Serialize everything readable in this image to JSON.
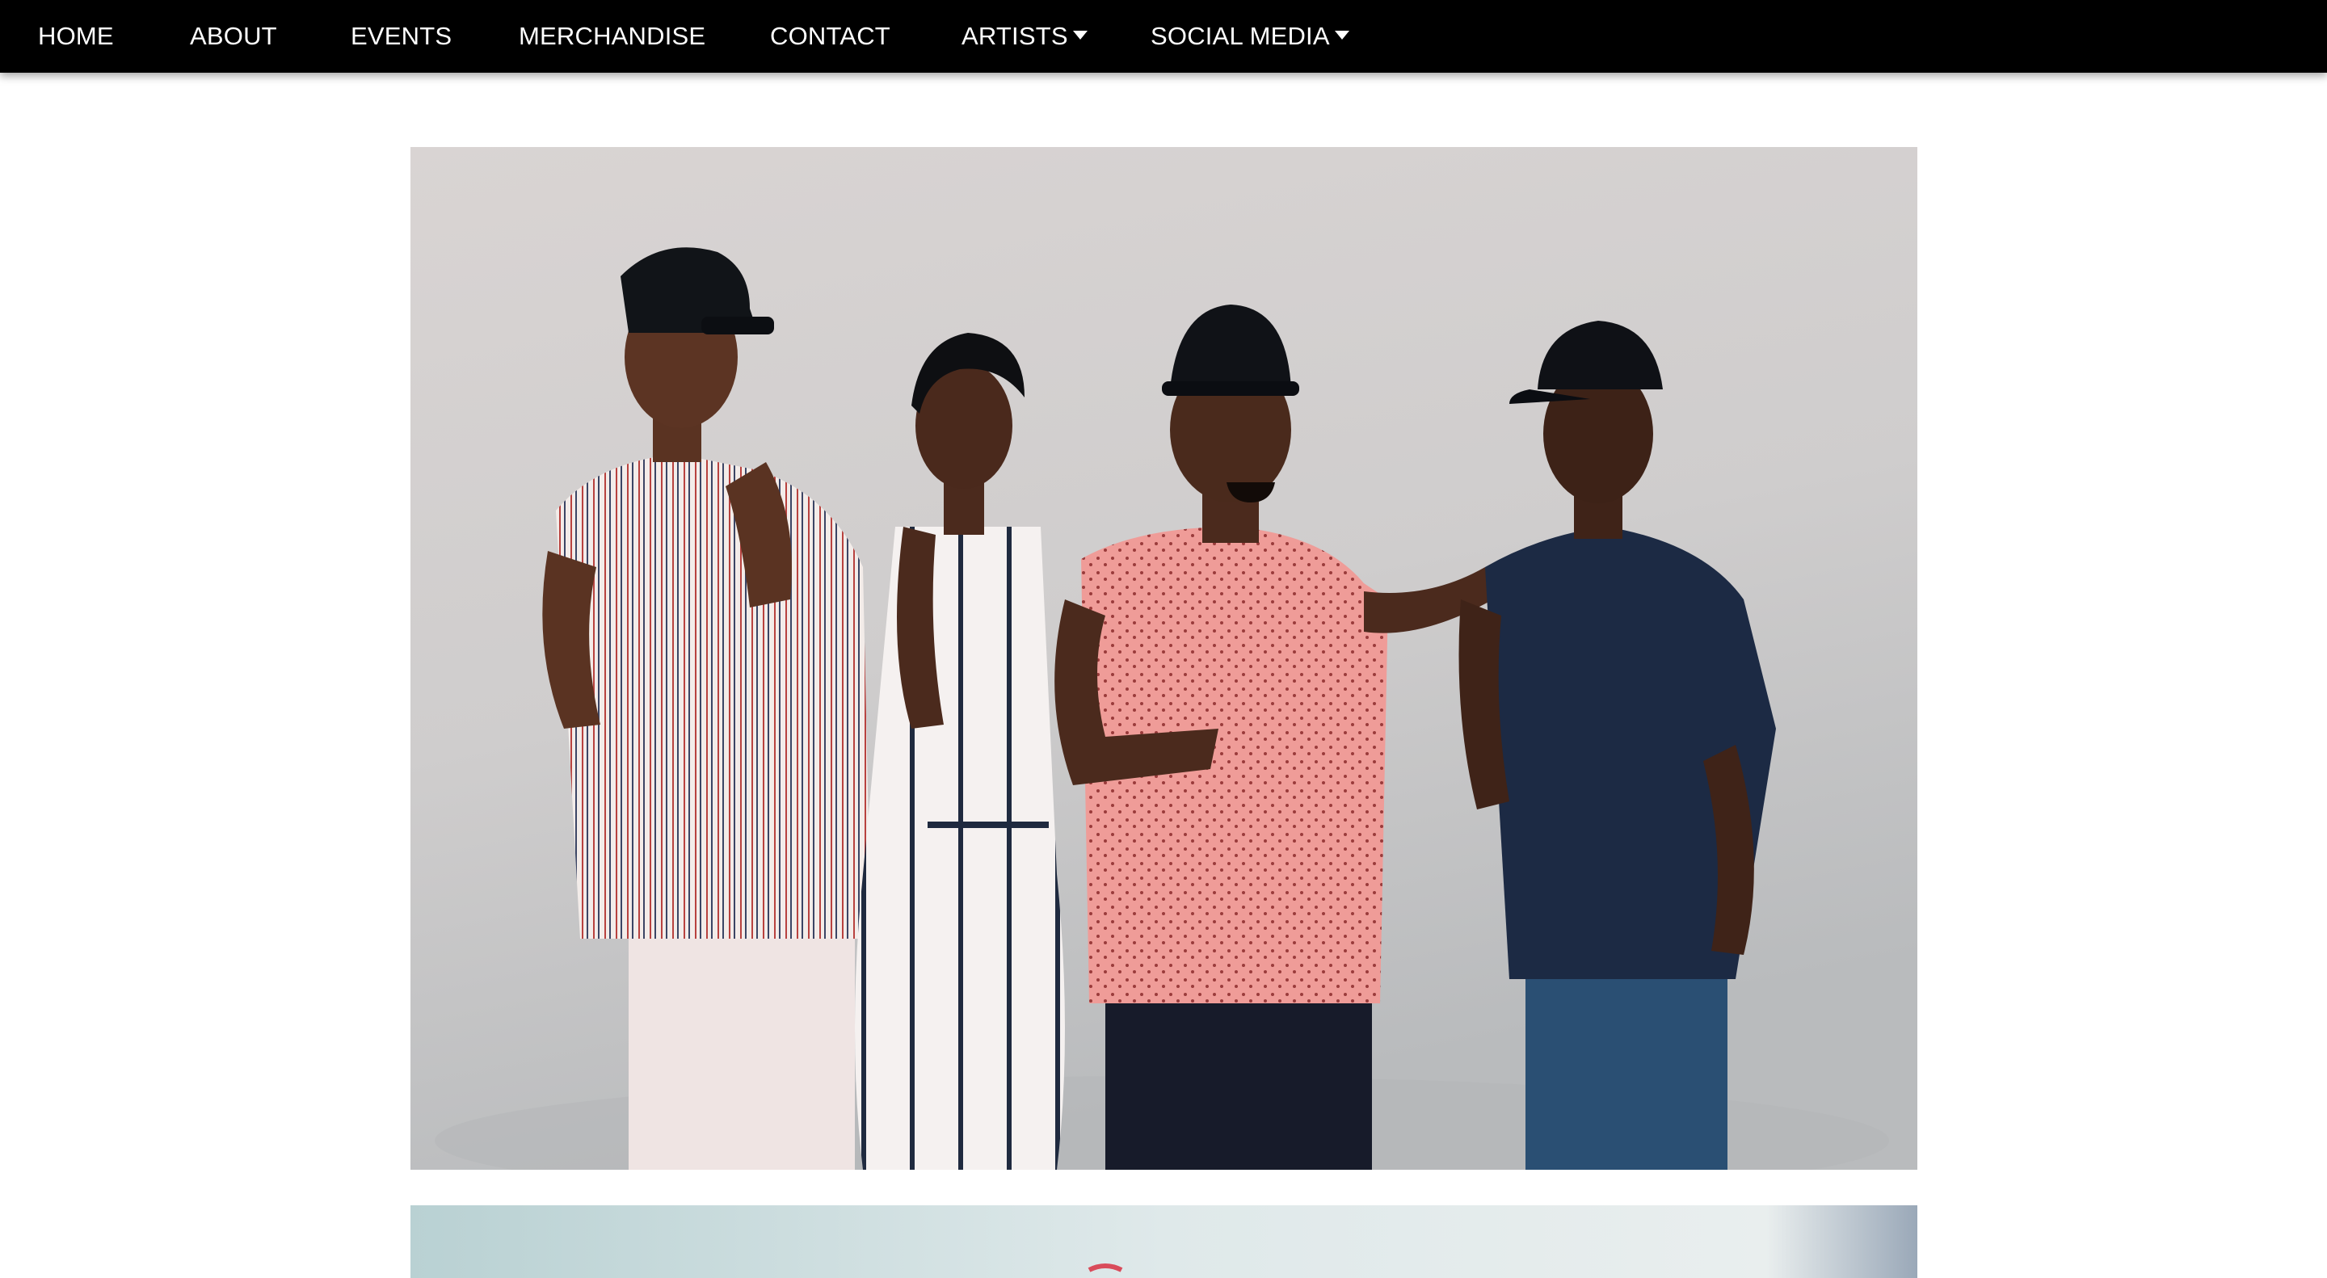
{
  "nav": {
    "items": [
      {
        "label": "HOME",
        "dropdown": false
      },
      {
        "label": "ABOUT",
        "dropdown": false
      },
      {
        "label": "EVENTS",
        "dropdown": false
      },
      {
        "label": "MERCHANDISE",
        "dropdown": false
      },
      {
        "label": "CONTACT",
        "dropdown": false
      },
      {
        "label": "ARTISTS",
        "dropdown": true
      },
      {
        "label": "SOCIAL MEDIA",
        "dropdown": true
      }
    ],
    "dropdown_icon": "caret-down-icon",
    "background": "#000000",
    "text_color": "#ffffff"
  },
  "gallery": {
    "images": [
      {
        "name": "group-photo"
      },
      {
        "name": "second-photo"
      }
    ]
  }
}
